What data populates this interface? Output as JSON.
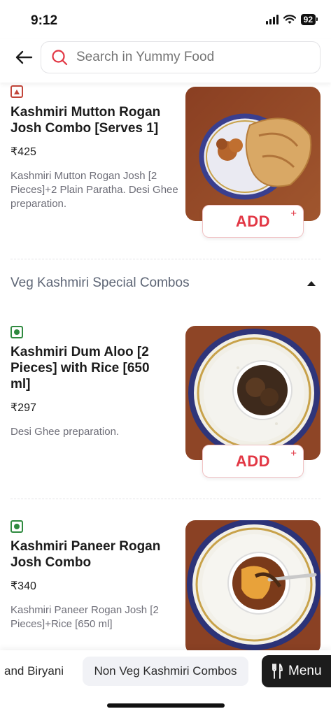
{
  "status": {
    "time": "9:12",
    "battery": "92"
  },
  "search": {
    "placeholder": "Search in Yummy Food"
  },
  "items": [
    {
      "name": "Kashmiri Mutton Rogan Josh Combo [Serves 1]",
      "price": "₹425",
      "description": "Kashmiri Mutton Rogan Josh [2 Pieces]+2 Plain Paratha. Desi Ghee preparation.",
      "diet": "non-veg",
      "add_label": "ADD",
      "add_plus": "+"
    },
    {
      "name": "Kashmiri Dum Aloo [2 Pieces] with Rice [650 ml]",
      "price": "₹297",
      "description": "Desi Ghee preparation.",
      "diet": "veg",
      "add_label": "ADD",
      "add_plus": "+"
    },
    {
      "name": "Kashmiri Paneer Rogan Josh Combo",
      "price": "₹340",
      "description": "Kashmiri Paneer Rogan Josh [2 Pieces]+Rice [650 ml]",
      "diet": "veg"
    }
  ],
  "section": {
    "title": "Veg Kashmiri Special Combos",
    "icon": "caret-up-icon"
  },
  "bottom_bar": {
    "categories": [
      "and Biryani",
      "Non Veg Kashmiri Combos"
    ],
    "menu_label": "Menu"
  },
  "colors": {
    "accent": "#e23744",
    "veg": "#2f8a3f",
    "non_veg": "#c2453a"
  }
}
